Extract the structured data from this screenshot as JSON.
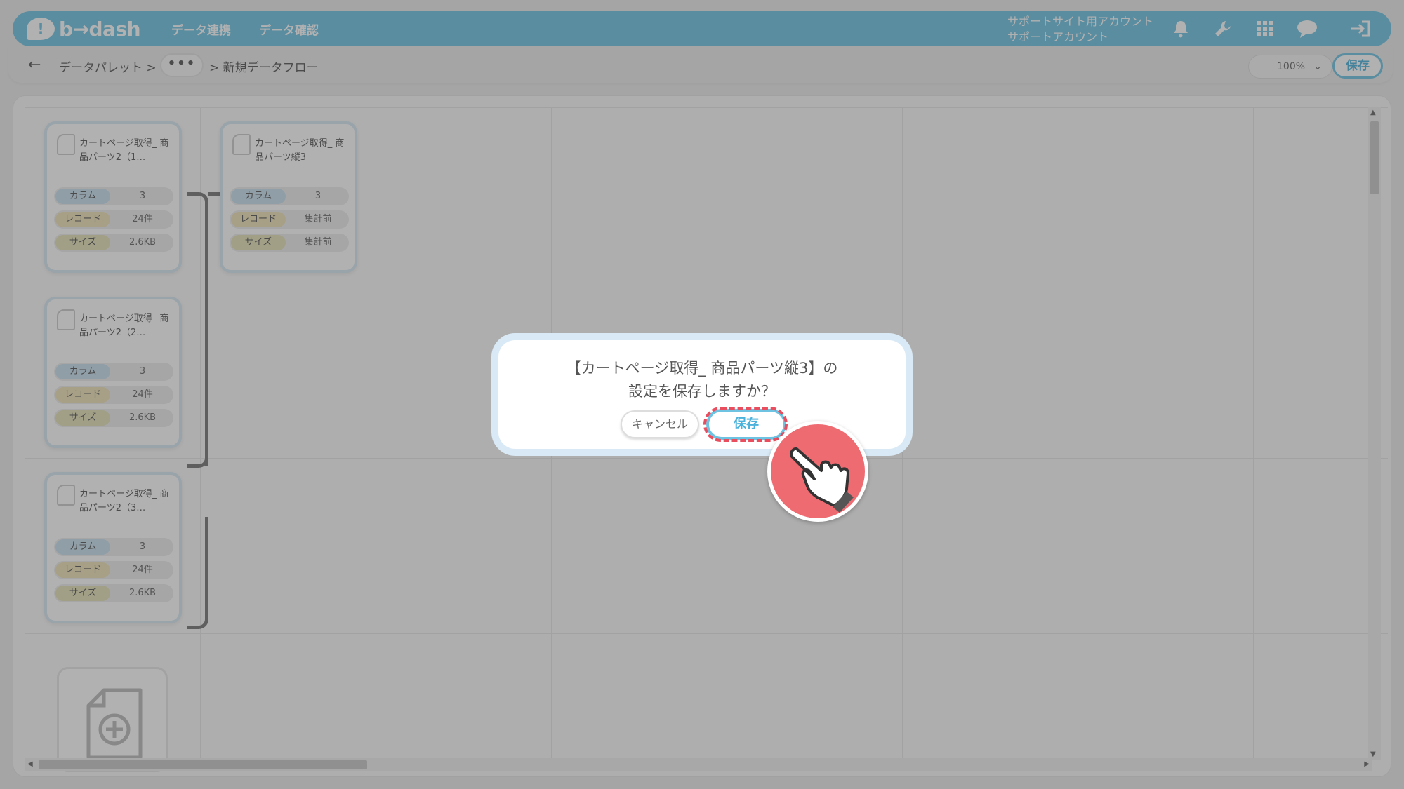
{
  "header": {
    "logo_text": "b→dash",
    "nav": [
      "データ連携",
      "データ確認"
    ],
    "account_line1": "サポートサイト用アカウント",
    "account_line2": "サポートアカウント",
    "icons": [
      "bell-icon",
      "wrench-icon",
      "grid-icon",
      "help-chat-icon",
      "logout-icon"
    ],
    "accent": "#6ec3e3"
  },
  "breadcrumb": {
    "back": "←",
    "root": "データパレット >",
    "ellipsis": "•••",
    "current": "> 新規データフロー"
  },
  "toolbar": {
    "zoom": "100%",
    "save_label": "保存"
  },
  "cards": [
    {
      "title": "カートページ取得_ 商品パーツ2（1…",
      "rows": [
        {
          "label": "カラム",
          "value": "3"
        },
        {
          "label": "レコード",
          "value": "24件"
        },
        {
          "label": "サイズ",
          "value": "2.6KB"
        }
      ]
    },
    {
      "title": "カートページ取得_ 商品パーツ縦3",
      "rows": [
        {
          "label": "カラム",
          "value": "3"
        },
        {
          "label": "レコード",
          "value": "集計前"
        },
        {
          "label": "サイズ",
          "value": "集計前"
        }
      ]
    },
    {
      "title": "カートページ取得_ 商品パーツ2（2…",
      "rows": [
        {
          "label": "カラム",
          "value": "3"
        },
        {
          "label": "レコード",
          "value": "24件"
        },
        {
          "label": "サイズ",
          "value": "2.6KB"
        }
      ]
    },
    {
      "title": "カートページ取得_ 商品パーツ2（3…",
      "rows": [
        {
          "label": "カラム",
          "value": "3"
        },
        {
          "label": "レコード",
          "value": "24件"
        },
        {
          "label": "サイズ",
          "value": "2.6KB"
        }
      ]
    }
  ],
  "dialog": {
    "line1": "【カートページ取得_ 商品パーツ縦3】の",
    "line2": "設定を保存しますか？",
    "cancel_label": "キャンセル",
    "save_label": "保存",
    "highlight_color": "#e94e5e"
  }
}
